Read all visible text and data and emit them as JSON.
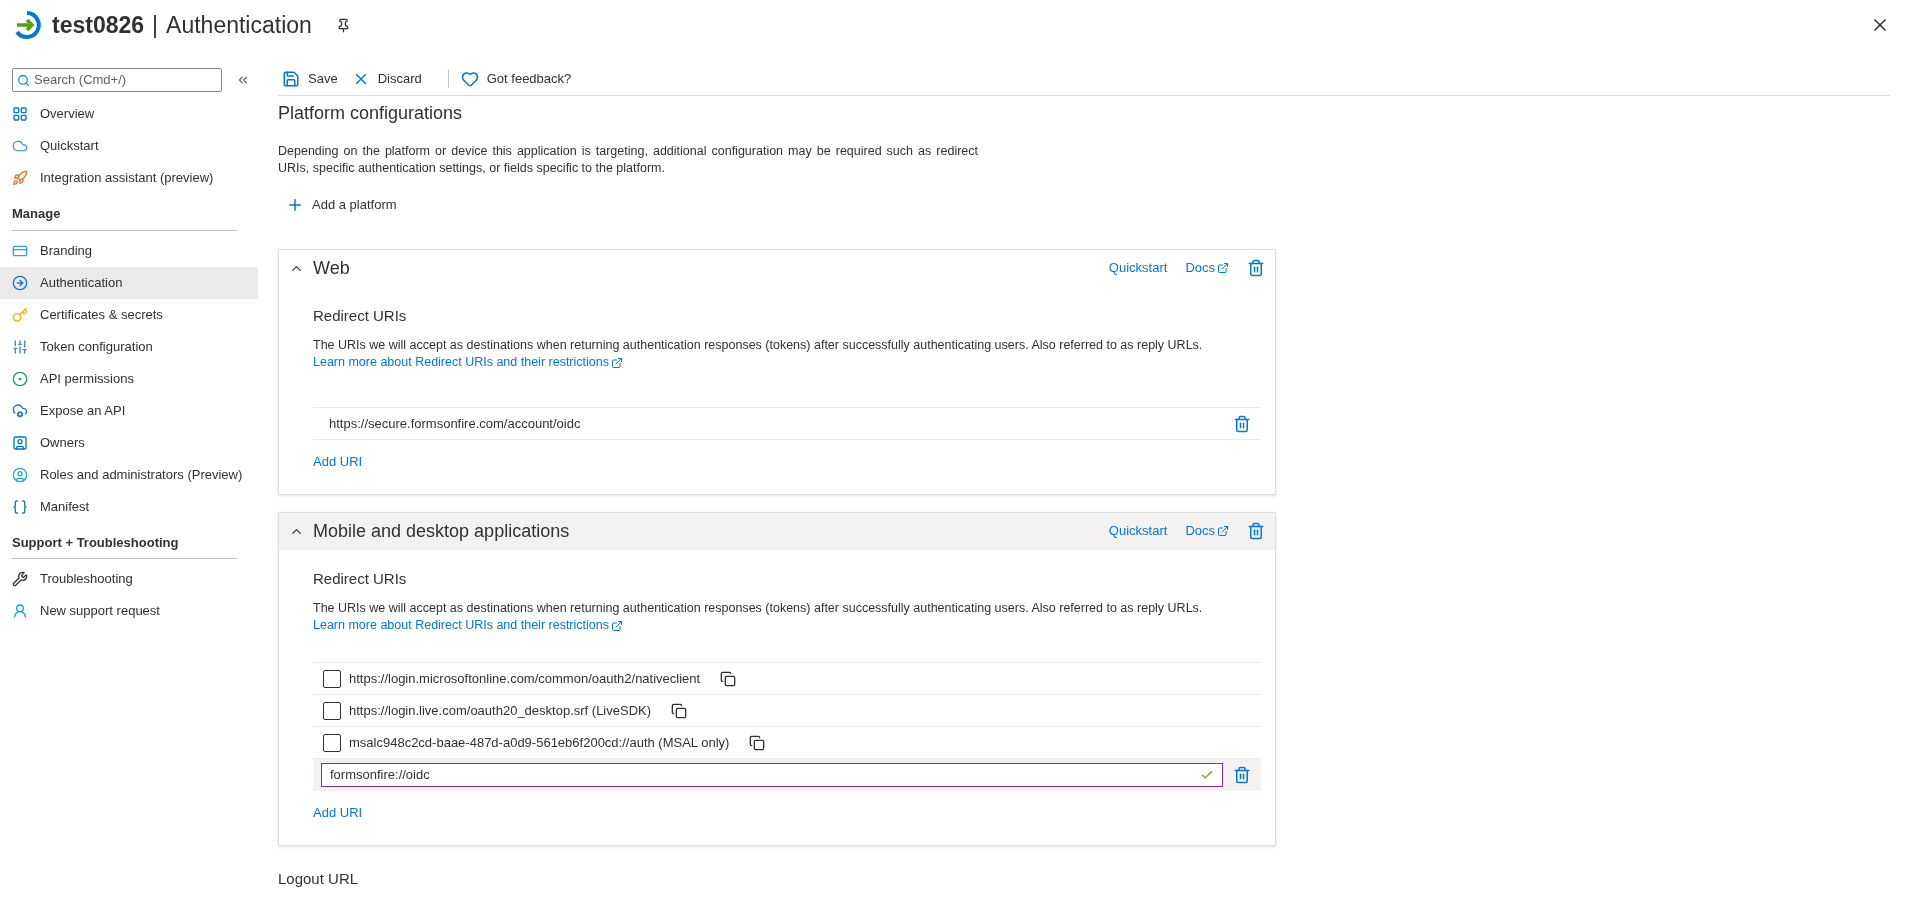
{
  "header": {
    "app": "test0826",
    "separator": "|",
    "page": "Authentication"
  },
  "sidebar": {
    "search": {
      "placeholder": "Search (Cmd+/)"
    },
    "items": [
      {
        "label": "Overview",
        "selected": false
      },
      {
        "label": "Quickstart",
        "selected": false
      },
      {
        "label": "Integration assistant (preview)",
        "selected": false
      }
    ],
    "sections": [
      {
        "title": "Manage",
        "items": [
          {
            "label": "Branding",
            "selected": false
          },
          {
            "label": "Authentication",
            "selected": true
          },
          {
            "label": "Certificates & secrets",
            "selected": false
          },
          {
            "label": "Token configuration",
            "selected": false
          },
          {
            "label": "API permissions",
            "selected": false
          },
          {
            "label": "Expose an API",
            "selected": false
          },
          {
            "label": "Owners",
            "selected": false
          },
          {
            "label": "Roles and administrators (Preview)",
            "selected": false
          },
          {
            "label": "Manifest",
            "selected": false
          }
        ]
      },
      {
        "title": "Support + Troubleshooting",
        "items": [
          {
            "label": "Troubleshooting",
            "selected": false
          },
          {
            "label": "New support request",
            "selected": false
          }
        ]
      }
    ]
  },
  "toolbar": [
    {
      "kind": "save",
      "label": "Save"
    },
    {
      "kind": "discard",
      "label": "Discard"
    },
    {
      "kind": "feedback",
      "label": "Got feedback?"
    }
  ],
  "platform_configurations": {
    "title": "Platform configurations",
    "description": "Depending on the platform or device this application is targeting, additional configuration may be required such as redirect URIs, specific authentication settings, or fields specific to the platform.",
    "add_button": "Add a platform"
  },
  "platforms": [
    {
      "title": "Web",
      "expanded": true,
      "highlighted": false,
      "quickstart": "Quickstart",
      "docs": "Docs",
      "section_title": "Redirect URIs",
      "description": "The URIs we will accept as destinations when returning authentication responses (tokens) after successfully authenticating users. Also referred to as reply URLs.",
      "learn_more": "Learn more about Redirect URIs and their restrictions",
      "add_uri": "Add URI",
      "uris": [
        {
          "kind": "plain",
          "value": "https://secure.formsonfire.com/account/oidc"
        }
      ]
    },
    {
      "title": "Mobile and desktop applications",
      "expanded": true,
      "highlighted": true,
      "quickstart": "Quickstart",
      "docs": "Docs",
      "section_title": "Redirect URIs",
      "description": "The URIs we will accept as destinations when returning authentication responses (tokens) after successfully authenticating users. Also referred to as reply URLs.",
      "learn_more": "Learn more about Redirect URIs and their restrictions",
      "add_uri": "Add URI",
      "uris": [
        {
          "kind": "checkbox",
          "value": "https://login.microsoftonline.com/common/oauth2/nativeclient",
          "checked": false
        },
        {
          "kind": "checkbox",
          "value": "https://login.live.com/oauth20_desktop.srf (LiveSDK)",
          "checked": false
        },
        {
          "kind": "checkbox",
          "value": "msalc948c2cd-baae-487d-a0d9-561eb6f200cd://auth (MSAL only)",
          "checked": false
        },
        {
          "kind": "input",
          "value": "formsonfire://oidc",
          "valid": true
        }
      ]
    }
  ],
  "logout": {
    "title": "Logout URL"
  }
}
